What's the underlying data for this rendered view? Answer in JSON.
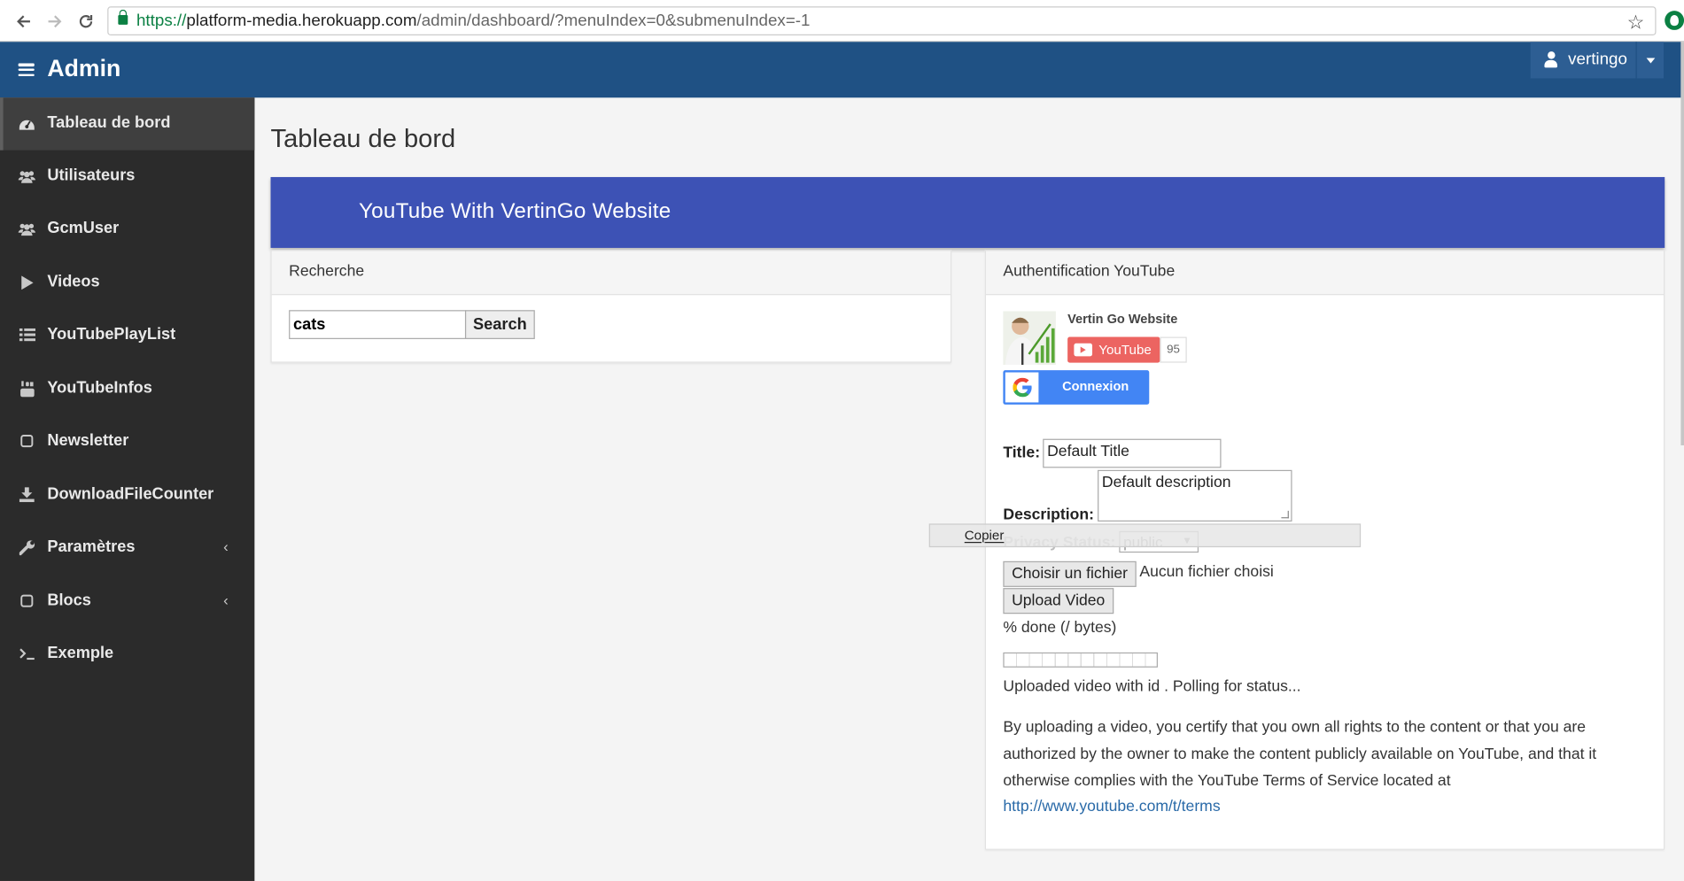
{
  "browser": {
    "url_protocol": "https://",
    "url_host": "platform-media.herokuapp.com",
    "url_path": "/admin/dashboard/?menuIndex=0&submenuIndex=-1",
    "star_icon": "☆"
  },
  "header": {
    "brand": "Admin",
    "username": "vertingo"
  },
  "sidebar": {
    "items": [
      {
        "label": "Tableau de bord",
        "icon": "dashboard-icon",
        "active": true
      },
      {
        "label": "Utilisateurs",
        "icon": "users-icon"
      },
      {
        "label": "GcmUser",
        "icon": "users-icon"
      },
      {
        "label": "Videos",
        "icon": "play-icon"
      },
      {
        "label": "YouTubePlayList",
        "icon": "list-icon"
      },
      {
        "label": "YouTubeInfos",
        "icon": "youtube-icon"
      },
      {
        "label": "Newsletter",
        "icon": "square-icon"
      },
      {
        "label": "DownloadFileCounter",
        "icon": "download-icon"
      },
      {
        "label": "Paramètres",
        "icon": "wrench-icon",
        "chevron": "‹"
      },
      {
        "label": "Blocs",
        "icon": "square-icon",
        "chevron": "‹"
      },
      {
        "label": "Exemple",
        "icon": "terminal-icon"
      }
    ]
  },
  "main": {
    "page_title": "Tableau de bord",
    "banner_title": "YouTube With VertinGo Website"
  },
  "search_panel": {
    "title": "Recherche",
    "input_value": "cats",
    "button_label": "Search"
  },
  "auth_panel": {
    "title": "Authentification YouTube",
    "channel_name": "Vertin Go Website",
    "youtube_label": "YouTube",
    "subscriber_count": "95",
    "google_button": "Connexion",
    "title_label": "Title:",
    "title_value": "Default Title",
    "description_label": "Description:",
    "description_value": "Default description",
    "privacy_label": "Privacy Status:",
    "privacy_value": "public",
    "choose_file_button": "Choisir un fichier",
    "no_file_text": "Aucun fichier choisi",
    "upload_button": "Upload Video",
    "progress_text": "% done (/ bytes)",
    "progress_fraction": 0,
    "status_text": "Uploaded video with id . Polling for status...",
    "terms_text": "By uploading a video, you certify that you own all rights to the content or that you are authorized by the owner to make the content publicly available on YouTube, and that it otherwise complies with the YouTube Terms of Service located at",
    "terms_link": "http://www.youtube.com/t/terms"
  },
  "context_menu": {
    "item": "Copier"
  },
  "colors": {
    "topnav": "#1f5184",
    "sidebar": "#2b2b2b",
    "banner": "#3d52b5",
    "google_blue": "#4285f4",
    "youtube_red": "#ec6461"
  }
}
